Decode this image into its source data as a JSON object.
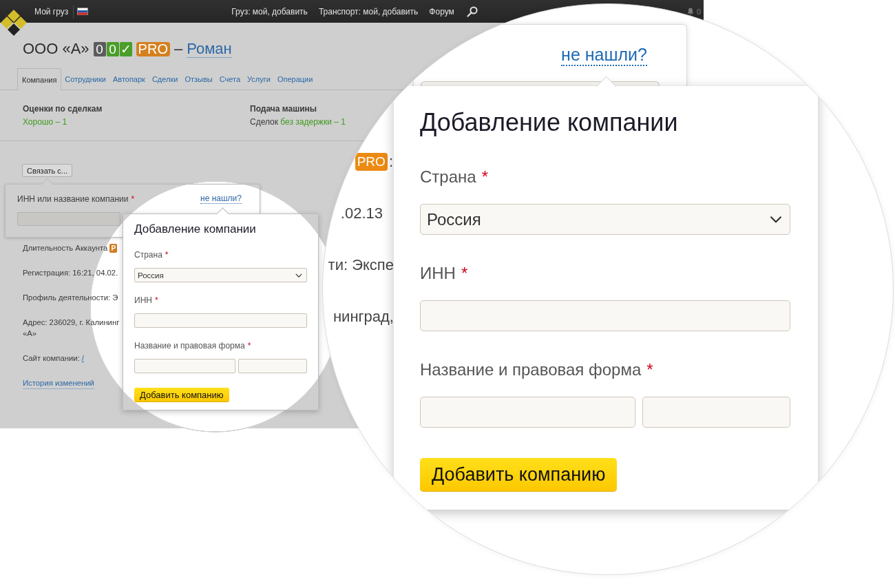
{
  "header": {
    "home_link": "Мой груз",
    "nav": [
      "Груз: мой, добавить",
      "Транспорт: мой, добавить",
      "Форум"
    ],
    "notifications": "0"
  },
  "company": {
    "name": "ООО «А»",
    "counters": [
      {
        "text": "0",
        "kind": "neutral"
      },
      {
        "text": "0",
        "kind": "positive"
      },
      {
        "text": "✓",
        "kind": "positive"
      }
    ],
    "badge": "PRO",
    "separator": "–",
    "owner": "Роман"
  },
  "tabs": [
    {
      "label": "Компания",
      "selected": true
    },
    {
      "label": "Сотрудники",
      "selected": false
    },
    {
      "label": "Автопарк",
      "selected": false
    },
    {
      "label": "Сделки",
      "selected": false
    },
    {
      "label": "Отзывы",
      "selected": false
    },
    {
      "label": "Счета",
      "selected": false
    },
    {
      "label": "Услуги",
      "selected": false
    },
    {
      "label": "Операции",
      "selected": false
    }
  ],
  "stats": [
    {
      "title": "Оценки по сделкам",
      "value": "Хорошо – 1"
    },
    {
      "title": "Подача машины",
      "prefix": "Сделок",
      "value": "без задержки – 1"
    }
  ],
  "contact_button": "Связать с...",
  "company_search": {
    "label": "ИНН или название компании",
    "required_mark": "*",
    "link": "не нашли?"
  },
  "details": [
    {
      "kind": "badge",
      "label": "Длительность Аккаунта",
      "badge": "P"
    },
    {
      "kind": "text",
      "lines": [
        "Регистрация: 16:21, 04.02."
      ]
    },
    {
      "kind": "text",
      "lines": [
        "Профиль деятельности: Э"
      ]
    },
    {
      "kind": "text",
      "lines": [
        "Адрес: 236029, г. Калининг",
        "«А»"
      ]
    },
    {
      "kind": "link",
      "label": "Сайт компании:",
      "link": "/"
    },
    {
      "kind": "history",
      "link": "История изменений"
    }
  ],
  "add_company": {
    "title": "Добавление компании",
    "fields": [
      {
        "kind": "select",
        "label": "Страна",
        "required_mark": "*",
        "value": "Россия"
      },
      {
        "kind": "input",
        "label": "ИНН",
        "required_mark": "*"
      },
      {
        "kind": "pair",
        "label": "Название и правовая форма",
        "required_mark": "*"
      }
    ],
    "submit": "Добавить компанию"
  },
  "magnifier": {
    "link": "не нашли?",
    "fragments": [
      {
        "kind": "badge",
        "text": "PRO",
        "suffix": ":"
      },
      {
        "kind": "text",
        "text": ".02.13"
      },
      {
        "kind": "text",
        "text": "ти: Экспе"
      },
      {
        "kind": "text",
        "text": "нинград,"
      }
    ],
    "add_company": {
      "title": "Добавление компании",
      "fields": [
        {
          "kind": "select",
          "label": "Страна",
          "required_mark": "*",
          "value": "Россия"
        },
        {
          "kind": "input",
          "label": "ИНН",
          "required_mark": "*"
        },
        {
          "kind": "pair",
          "label": "Название и правовая форма",
          "required_mark": "*"
        }
      ],
      "submit": "Добавить компанию"
    }
  }
}
